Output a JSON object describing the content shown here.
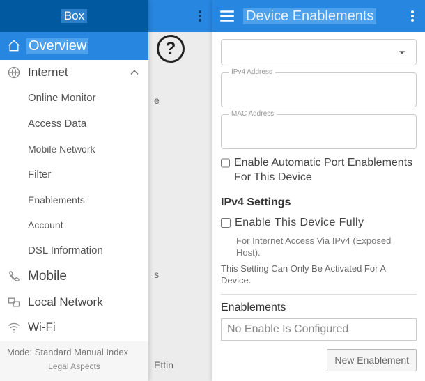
{
  "sidebar": {
    "brand": "Box",
    "overview": "Overview",
    "internet": {
      "label": "Internet",
      "children": [
        "Online Monitor",
        "Access Data",
        "Mobile Network",
        "Filter",
        "Enablements",
        "Account",
        "DSL Information"
      ]
    },
    "mobile": "Mobile",
    "localnet": "Local Network",
    "wifi": "Wi-Fi",
    "footer_mode": "Mode: Standard Manual Index",
    "footer_legal": "Legal Aspects"
  },
  "mid": {
    "frag1": "e",
    "frag2": "s",
    "frag3": "Ettin"
  },
  "panel": {
    "title": "Device Enablements",
    "dropdown_value": "",
    "ipv4_label": "IPv4 Address",
    "mac_label": "MAC Address",
    "chk_auto": "Enable Automatic Port Enablements For This Device",
    "section_ipv4": "IPv4 Settings",
    "chk_full": "Enable This Device Fully",
    "hint_full": "For Internet Access Via IPv4 (Exposed Host).",
    "hint_note": "This Setting Can Only Be Activated For A Device.",
    "section_enab": "Enablements",
    "enab_empty": "No Enable Is Configured",
    "btn_new": "New Enablement"
  }
}
